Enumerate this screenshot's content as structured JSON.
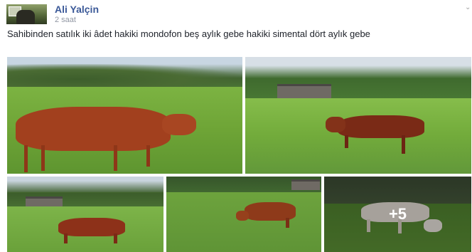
{
  "post": {
    "author": "Ali Yalçin",
    "time": "2 saat",
    "text": "Sahibinden satılık iki âdet hakiki mondofon beş aylık gebe hakiki simental dört aylık gebe",
    "photos": [
      {
        "label": "photo-1"
      },
      {
        "label": "photo-2"
      },
      {
        "label": "photo-3"
      },
      {
        "label": "photo-4"
      },
      {
        "label": "photo-5"
      }
    ],
    "more_count": "+5"
  },
  "icons": {
    "avatar": "profile-picture",
    "menu": "more-options-icon"
  }
}
